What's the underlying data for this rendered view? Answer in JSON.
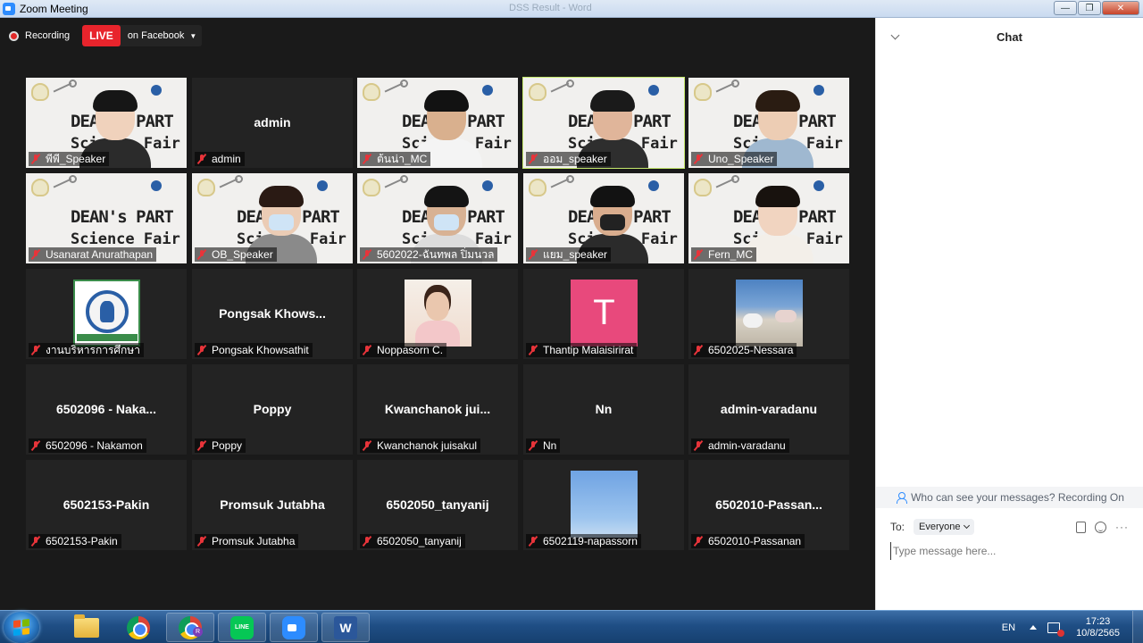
{
  "window": {
    "title": "Zoom Meeting",
    "background_title": "DSS Result - Word"
  },
  "recording": {
    "label": "Recording",
    "live_badge": "LIVE",
    "live_target": "on Facebook"
  },
  "banner": {
    "line1": "DEAN's PART",
    "line2": "Science Fair 20"
  },
  "grid": {
    "row1": [
      {
        "label": "พีพี_Speaker",
        "kind": "video"
      },
      {
        "label": "admin",
        "big": "admin",
        "kind": "name"
      },
      {
        "label": "ต้นน่า_MC",
        "kind": "video"
      },
      {
        "label": "ออม_speaker",
        "kind": "video"
      },
      {
        "label": "Uno_Speaker",
        "kind": "video"
      }
    ],
    "row2": [
      {
        "label": "Usanarat Anurathapan",
        "kind": "video"
      },
      {
        "label": "OB_Speaker",
        "kind": "video"
      },
      {
        "label": "5602022-ฉันทพล ปิ่มนวล",
        "kind": "video"
      },
      {
        "label": "แยม_speaker",
        "kind": "video"
      },
      {
        "label": "Fern_MC",
        "kind": "video"
      }
    ],
    "row3": [
      {
        "label": "งานบริหารการศึกษา",
        "kind": "seal"
      },
      {
        "label": "Pongsak Khowsathit",
        "big": "Pongsak  Khows...",
        "kind": "name"
      },
      {
        "label": "Noppasorn C.",
        "kind": "photo-girl"
      },
      {
        "label": "Thantip Malaisirirat",
        "avatar_letter": "T",
        "kind": "letter"
      },
      {
        "label": "6502025-Nessara",
        "kind": "photo-table"
      }
    ],
    "row4": [
      {
        "label": "6502096 - Nakamon",
        "big": "6502096 - Naka...",
        "kind": "name"
      },
      {
        "label": "Poppy",
        "big": "Poppy",
        "kind": "name"
      },
      {
        "label": "Kwanchanok juisakul",
        "big": "Kwanchanok  jui...",
        "kind": "name"
      },
      {
        "label": "Nn",
        "big": "Nn",
        "kind": "name"
      },
      {
        "label": "admin-varadanu",
        "big": "admin-varadanu",
        "kind": "name"
      }
    ],
    "row5": [
      {
        "label": "6502153-Pakin",
        "big": "6502153-Pakin",
        "kind": "name"
      },
      {
        "label": "Promsuk Jutabha",
        "big": "Promsuk Jutabha",
        "kind": "name"
      },
      {
        "label": "6502050_tanyanij",
        "big": "6502050_tanyanij",
        "kind": "name"
      },
      {
        "label": "6502119-napassorn",
        "kind": "photo-sky"
      },
      {
        "label": "6502010-Passanan",
        "big": "6502010-Passan...",
        "kind": "name"
      }
    ]
  },
  "chat": {
    "title": "Chat",
    "privacy_notice": "Who can see your messages? Recording On",
    "to_label": "To:",
    "recipient": "Everyone",
    "input_placeholder": "Type message here..."
  },
  "taskbar": {
    "language": "EN",
    "time": "17:23",
    "date": "10/8/2565",
    "chrome_badge": "R",
    "line_label": "LINE"
  },
  "colors": {
    "live": "#e8242c",
    "active_speaker": "#c5e86c",
    "zoom_blue": "#2d8cff",
    "avatar_pink": "#e8497c"
  }
}
